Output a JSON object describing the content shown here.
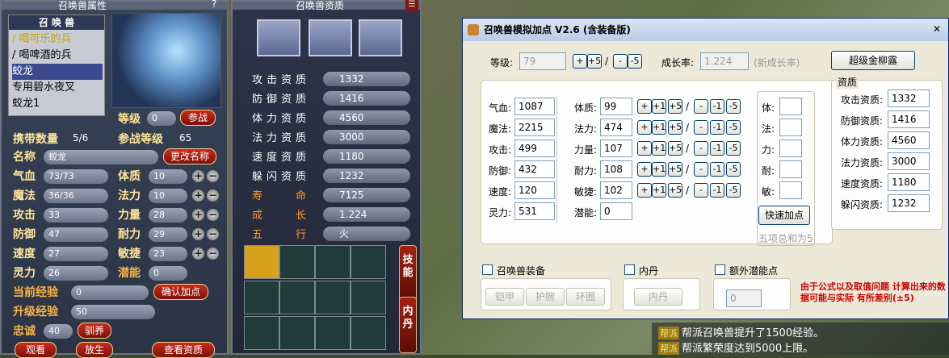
{
  "left_panel": {
    "title": "召唤兽属性",
    "help": "?",
    "list_header": "召 唤 兽",
    "pets": [
      "喝可乐的兵",
      "喝啤酒的兵",
      "蛟龙",
      "专用碧水夜叉",
      "蛟龙1"
    ],
    "pet_marks": [
      "/",
      "/"
    ],
    "level_label": "等级",
    "level_value": "0",
    "fight_button": "参战",
    "carry_label": "携带数量",
    "carry_value": "5/6",
    "fight_level_label": "参战等级",
    "fight_level_value": "65",
    "name_label": "名称",
    "name_value": "蛟龙",
    "rename_button": "更改名称",
    "hp_label": "气血",
    "hp_value": "73/73",
    "mp_label": "魔法",
    "mp_value": "36/36",
    "atk_label": "攻击",
    "atk_value": "33",
    "def_label": "防御",
    "def_value": "47",
    "spd_label": "速度",
    "spd_value": "27",
    "sp_label": "灵力",
    "sp_value": "26",
    "con_label": "体质",
    "con_value": "10",
    "mag_label": "法力",
    "mag_value": "10",
    "str_label": "力量",
    "str_value": "28",
    "end_label": "耐力",
    "end_value": "29",
    "agi_label": "敏捷",
    "agi_value": "23",
    "pot_label": "潜能",
    "pot_value": "0",
    "exp_label": "当前经验",
    "exp_value": "0",
    "confirm_button": "确认加点",
    "next_exp_label": "升级经验",
    "next_exp_value": "50",
    "loyal_label": "忠诚",
    "loyal_value": "40",
    "tame_button": "驯养",
    "view_button": "观看",
    "release_button": "放生",
    "check_button": "查看资质",
    "plus": "+",
    "minus": "−"
  },
  "mid_panel": {
    "title": "召唤兽资质",
    "menu": "☰",
    "rows": [
      {
        "label": "攻击资质",
        "value": "1332"
      },
      {
        "label": "防御资质",
        "value": "1416"
      },
      {
        "label": "体力资质",
        "value": "4560"
      },
      {
        "label": "法力资质",
        "value": "3000"
      },
      {
        "label": "速度资质",
        "value": "1180"
      },
      {
        "label": "躲闪资质",
        "value": "1232"
      },
      {
        "label": "寿　　命",
        "value": "7125"
      },
      {
        "label": "成　　长",
        "value": "1.224"
      },
      {
        "label": "五　　行",
        "value": "火"
      }
    ],
    "skill_button": "技能",
    "inner_button": "内丹"
  },
  "dialog": {
    "title": "召唤兽模拟加点 V2.6 (含装备版)",
    "close": "✕",
    "level_label": "等级:",
    "level_value": "79",
    "plus5": "+5",
    "plus": "+",
    "slash": "/",
    "minus": "-",
    "minus5": "-5",
    "growth_label": "成长率:",
    "growth_value": "1.224",
    "growth_hint": "(新成长率)",
    "super_button": "超级金柳露",
    "attr_labels": [
      "气血:",
      "魔法:",
      "攻击:",
      "防御:",
      "速度:",
      "灵力:"
    ],
    "attr_values": [
      "1087",
      "2215",
      "499",
      "432",
      "120",
      "531"
    ],
    "base_labels": [
      "体质:",
      "法力:",
      "力量:",
      "耐力:",
      "敏捷:",
      "潜能:"
    ],
    "base_values": [
      "99",
      "474",
      "107",
      "108",
      "102",
      "0"
    ],
    "plus1": "+1",
    "minus1": "-1",
    "alloc_labels": [
      "体:",
      "法:",
      "力:",
      "耐:",
      "敏:"
    ],
    "quick_button": "快速加点",
    "sum_hint": "五项总和为5",
    "apt_title": "资质",
    "apt_labels": [
      "攻击资质:",
      "防御资质:",
      "体力资质:",
      "法力资质:",
      "速度资质:",
      "躲闪资质:"
    ],
    "apt_values": [
      "1332",
      "1416",
      "4560",
      "3000",
      "1180",
      "1232"
    ],
    "equip_check": "召唤兽装备",
    "equip_buttons": [
      "铠甲",
      "护腕",
      "环圈"
    ],
    "inner_check": "内丹",
    "inner_button": "内丹",
    "extra_check": "额外潜能点",
    "extra_value": "0",
    "warning": "由于公式以及取值问题 计算出来的数据可能与实际 有所差别(±5)"
  },
  "chat": {
    "tag": "帮派",
    "lines": [
      "帮派召唤兽提升了1500经验。",
      "帮派繁荣度达到5000上限。"
    ]
  },
  "colors": {
    "warning": "#cc0000",
    "title_bar": "#b9cbe6",
    "accent_red": "#b3200f"
  }
}
